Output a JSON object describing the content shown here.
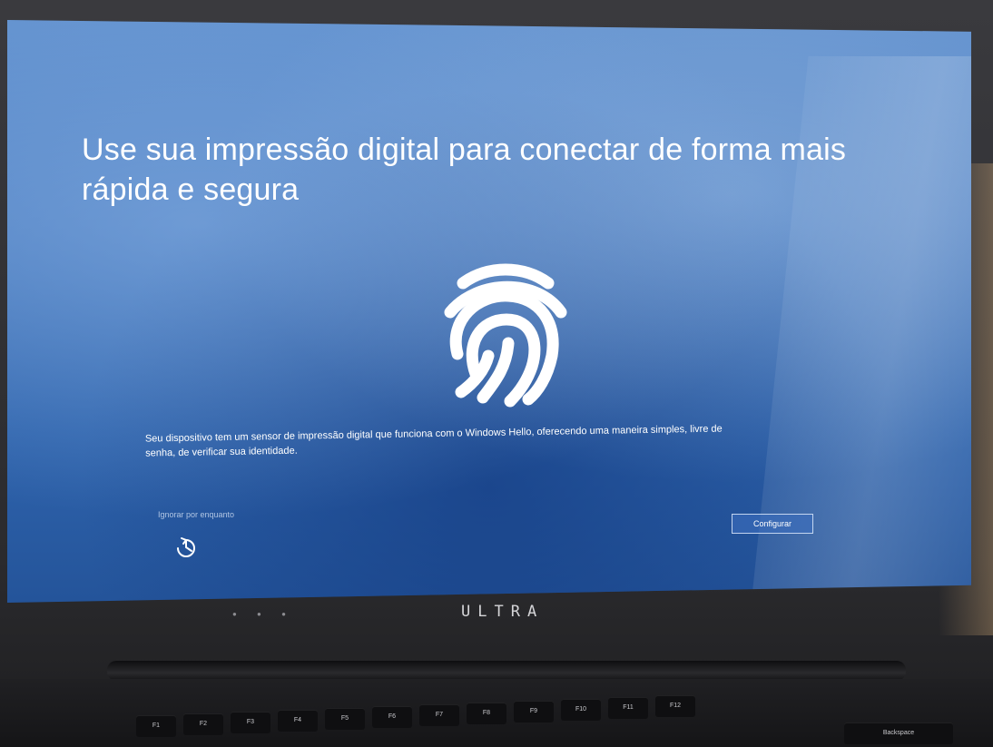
{
  "screen": {
    "title": "Use sua impressão digital para conectar de forma mais rápida e segura",
    "description": "Seu dispositivo tem um sensor de impressão digital que funciona com o Windows Hello, oferecendo uma maneira simples, livre de senha, de verificar sua identidade.",
    "skip_label": "Ignorar por enquanto",
    "configure_label": "Configurar",
    "icons": [
      "fingerprint-icon",
      "accessibility-icon"
    ]
  },
  "device": {
    "brand": "ULTRA",
    "keys": [
      "F1",
      "F2",
      "F3",
      "F4",
      "F5",
      "F6",
      "F7",
      "F8",
      "F9",
      "F10",
      "F11",
      "F12",
      "Backspace"
    ]
  }
}
